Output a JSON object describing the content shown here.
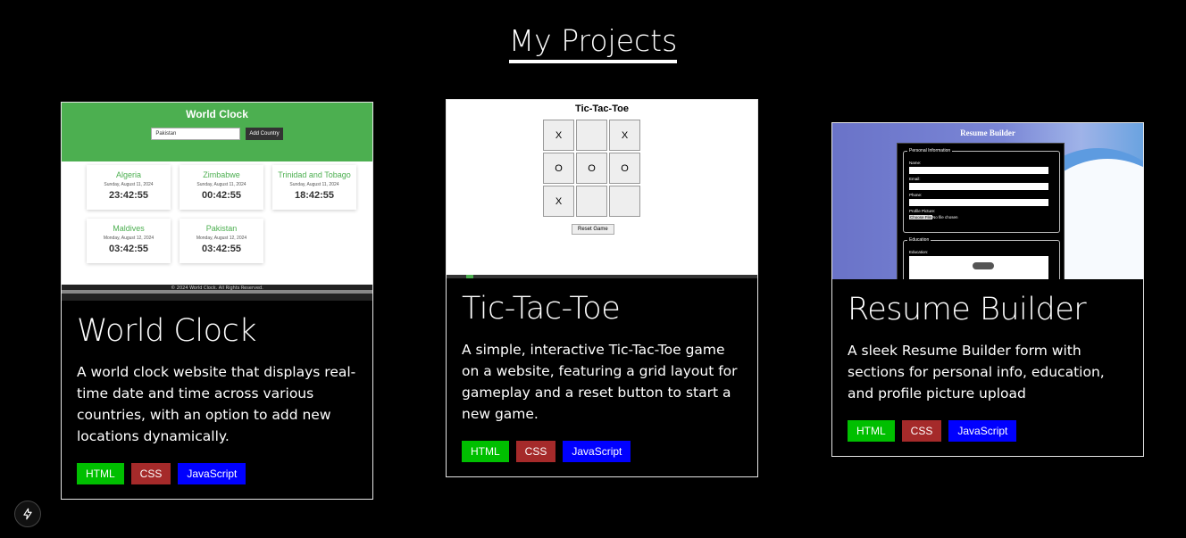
{
  "page": {
    "title": "My Projects"
  },
  "colors": {
    "html": "#00bf00",
    "css": "#a52a2a",
    "javascript": "#0000ff"
  },
  "projects": [
    {
      "title": "World Clock",
      "description": "A world clock website that displays real-time date and time across various countries, with an option to add new locations dynamically.",
      "tags": [
        "HTML",
        "CSS",
        "JavaScript"
      ],
      "preview": {
        "heading": "World Clock",
        "select_value": "Pakistan",
        "add_button": "Add Country",
        "clocks": [
          {
            "country": "Algeria",
            "date": "Sunday, August 11, 2024",
            "time": "23:42:55"
          },
          {
            "country": "Zimbabwe",
            "date": "Sunday, August 11, 2024",
            "time": "00:42:55"
          },
          {
            "country": "Trinidad and Tobago",
            "date": "Sunday, August 11, 2024",
            "time": "18:42:55"
          },
          {
            "country": "Maldives",
            "date": "Monday, August 12, 2024",
            "time": "03:42:55"
          },
          {
            "country": "Pakistan",
            "date": "Monday, August 12, 2024",
            "time": "03:42:55"
          }
        ],
        "footer": "© 2024 World Clock. All Rights Reserved."
      }
    },
    {
      "title": "Tic-Tac-Toe",
      "description": "A simple, interactive Tic-Tac-Toe game on a website, featuring a grid layout for gameplay and a reset button to start a new game.",
      "tags": [
        "HTML",
        "CSS",
        "JavaScript"
      ],
      "preview": {
        "heading": "Tic-Tac-Toe",
        "cells": [
          "X",
          "",
          "X",
          "O",
          "O",
          "O",
          "X",
          "",
          ""
        ],
        "reset_button": "Reset Game"
      }
    },
    {
      "title": "Resume Builder",
      "description": "A sleek Resume Builder form with sections for personal info, education, and profile picture upload",
      "tags": [
        "HTML",
        "CSS",
        "JavaScript"
      ],
      "preview": {
        "heading": "Resume Builder",
        "personal_legend": "Personal Information",
        "fields": [
          "Name:",
          "Email:",
          "Phone:",
          "Profile Picture:"
        ],
        "file_button": "Choose File",
        "file_status": "No file chosen",
        "education_legend": "Education",
        "education_label": "Education:"
      }
    }
  ],
  "fab": {
    "icon": "lightning-icon"
  }
}
